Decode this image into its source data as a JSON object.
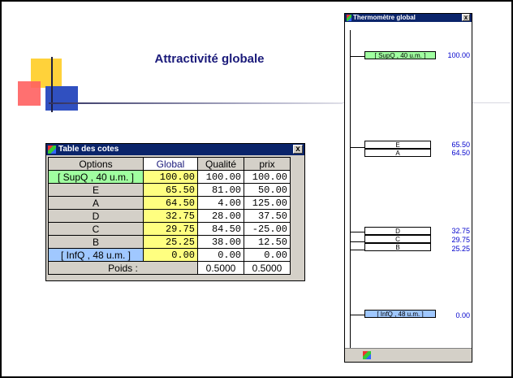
{
  "page": {
    "title": "Attractivité globale"
  },
  "table_window": {
    "title": "Table des cotes",
    "close": "x",
    "headers": [
      "Options",
      "Global",
      "Qualité",
      "prix"
    ],
    "rows": [
      {
        "option": "[ SupQ , 40 u.m. ]",
        "global": "100.00",
        "qualite": "100.00",
        "prix": "100.00"
      },
      {
        "option": "E",
        "global": "65.50",
        "qualite": "81.00",
        "prix": "50.00"
      },
      {
        "option": "A",
        "global": "64.50",
        "qualite": "4.00",
        "prix": "125.00"
      },
      {
        "option": "D",
        "global": "32.75",
        "qualite": "28.00",
        "prix": "37.50"
      },
      {
        "option": "C",
        "global": "29.75",
        "qualite": "84.50",
        "prix": "-25.00"
      },
      {
        "option": "B",
        "global": "25.25",
        "qualite": "38.00",
        "prix": "12.50"
      },
      {
        "option": "[ InfQ , 48 u.m. ]",
        "global": "0.00",
        "qualite": "0.00",
        "prix": "0.00"
      }
    ],
    "poids_label": "Poids :",
    "poids_qualite": "0.5000",
    "poids_prix": "0.5000"
  },
  "thermo_window": {
    "title": "Thermomètre global",
    "close": "x",
    "labels": {
      "sup": "[ SupQ , 40 u.m. ]",
      "e": "E",
      "a": "A",
      "d": "D",
      "c": "C",
      "b": "B",
      "inf": "[ InfQ , 48 u.m. ]"
    },
    "values": {
      "sup": "100.00",
      "e": "65.50",
      "a": "64.50",
      "d": "32.75",
      "c": "29.75",
      "b": "25.25",
      "inf": "0.00"
    }
  },
  "colors": {
    "sup": "#a0ffa0",
    "inf": "#a0c8ff",
    "global": "#ffff80",
    "titlebar": "#0a246a",
    "value": "#0000cc"
  }
}
